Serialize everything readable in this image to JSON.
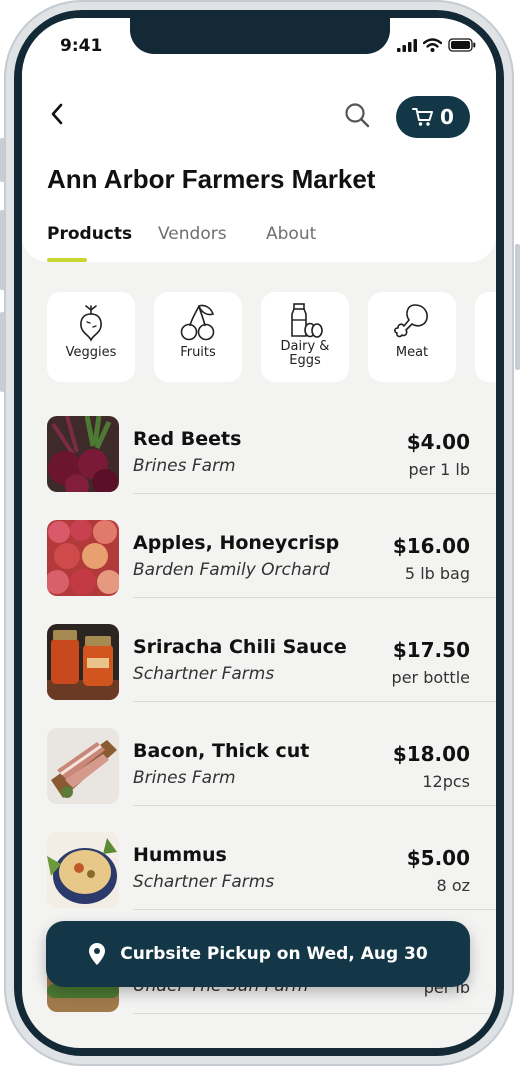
{
  "status_bar": {
    "time": "9:41"
  },
  "header": {
    "back_icon": "chevron-left-icon",
    "search_icon": "search-icon",
    "cart": {
      "icon": "cart-icon",
      "count": "0"
    },
    "title": "Ann Arbor Farmers Market"
  },
  "tabs": [
    {
      "label": "Products",
      "active": true
    },
    {
      "label": "Vendors",
      "active": false
    },
    {
      "label": "About",
      "active": false
    }
  ],
  "categories": [
    {
      "icon": "beet-icon",
      "label": "Veggies"
    },
    {
      "icon": "cherries-icon",
      "label": "Fruits"
    },
    {
      "icon": "milk-eggs-icon",
      "label": "Dairy &\nEggs"
    },
    {
      "icon": "drumstick-icon",
      "label": "Meat"
    }
  ],
  "products": [
    {
      "name": "Red Beets",
      "vendor": "Brines Farm",
      "price": "$4.00",
      "unit": "per 1 lb"
    },
    {
      "name": "Apples, Honeycrisp",
      "vendor": "Barden Family Orchard",
      "price": "$16.00",
      "unit": "5 lb bag"
    },
    {
      "name": "Sriracha Chili Sauce",
      "vendor": "Schartner Farms",
      "price": "$17.50",
      "unit": "per bottle"
    },
    {
      "name": "Bacon, Thick cut",
      "vendor": "Brines Farm",
      "price": "$18.00",
      "unit": "12pcs"
    },
    {
      "name": "Hummus",
      "vendor": "Schartner Farms",
      "price": "$5.00",
      "unit": "8 oz"
    },
    {
      "name": "",
      "vendor": "Under The Sun Farm",
      "price": "",
      "unit": "per lb"
    }
  ],
  "pickup": {
    "icon": "location-pin-icon",
    "label": "Curbsite Pickup on Wed, Aug 30"
  },
  "colors": {
    "accent_dark": "#133746",
    "tab_underline": "#c9d530",
    "background": "#f3f3f2"
  }
}
